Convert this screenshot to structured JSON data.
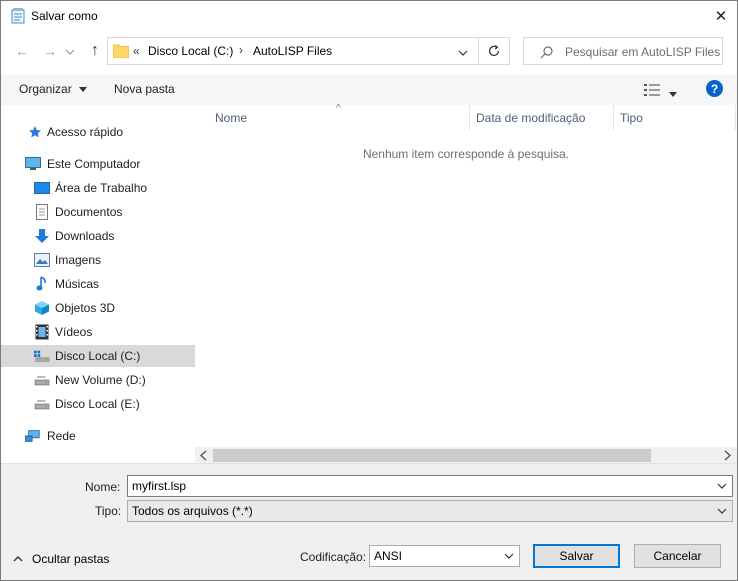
{
  "window": {
    "title": "Salvar como",
    "close_glyph": "✕"
  },
  "nav": {
    "back_glyph": "←",
    "forward_glyph": "→",
    "up_glyph": "↑"
  },
  "address": {
    "overflow": "«",
    "crumbs": [
      "Disco Local (C:)",
      "AutoLISP Files"
    ],
    "separator": "›"
  },
  "search": {
    "placeholder": "Pesquisar em AutoLISP Files"
  },
  "toolbar": {
    "organize_label": "Organizar",
    "new_folder_label": "Nova pasta",
    "help_glyph": "?"
  },
  "sidebar": {
    "items": [
      {
        "label": "Acesso rápido",
        "icon": "star-icon"
      },
      {
        "label": "Este Computador",
        "icon": "computer-icon"
      },
      {
        "label": "Área de Trabalho",
        "icon": "desktop-icon"
      },
      {
        "label": "Documentos",
        "icon": "documents-icon"
      },
      {
        "label": "Downloads",
        "icon": "downloads-icon"
      },
      {
        "label": "Imagens",
        "icon": "pictures-icon"
      },
      {
        "label": "Músicas",
        "icon": "music-icon"
      },
      {
        "label": "Objetos 3D",
        "icon": "3d-objects-icon"
      },
      {
        "label": "Vídeos",
        "icon": "videos-icon"
      },
      {
        "label": "Disco Local (C:)",
        "icon": "drive-c-icon",
        "selected": true
      },
      {
        "label": "New Volume (D:)",
        "icon": "drive-icon"
      },
      {
        "label": "Disco Local (E:)",
        "icon": "drive-icon"
      },
      {
        "label": "Rede",
        "icon": "network-icon"
      }
    ]
  },
  "filelist": {
    "columns": [
      "Nome",
      "Data de modificação",
      "Tipo"
    ],
    "sort_glyph": "^",
    "empty_message": "Nenhum item corresponde à pesquisa."
  },
  "form": {
    "name_label": "Nome:",
    "name_value": "myfirst.lsp",
    "type_label": "Tipo:",
    "type_value": "Todos os arquivos  (*.*)",
    "encoding_label": "Codificação:",
    "encoding_value": "ANSI",
    "hide_folders_label": "Ocultar pastas",
    "save_label": "Salvar",
    "cancel_label": "Cancelar"
  },
  "colors": {
    "accent": "#0078d7",
    "selected_bg": "#d9d9d9",
    "help_blue": "#0a64c8"
  }
}
